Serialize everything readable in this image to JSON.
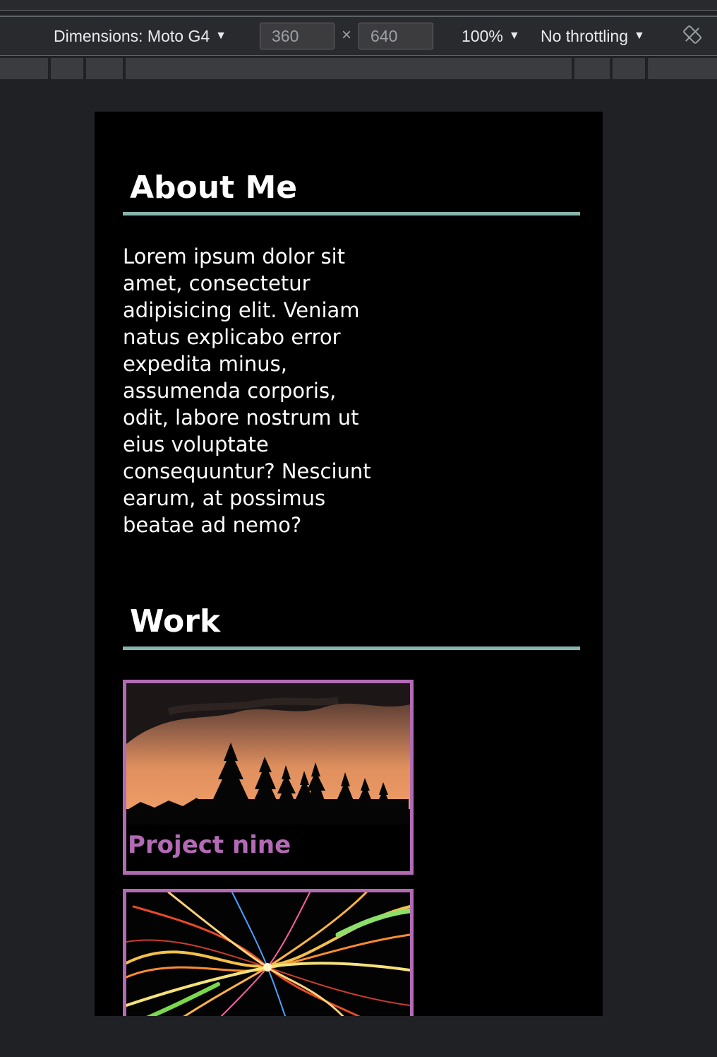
{
  "devtools": {
    "dimensions_label": "Dimensions: Moto G4",
    "width_value": "360",
    "height_value": "640",
    "times_symbol": "×",
    "zoom_label": "100%",
    "throttling_label": "No throttling",
    "caret": "▼"
  },
  "page": {
    "about": {
      "title": "About Me",
      "text": "Lorem ipsum dolor sit amet, consectetur adipisicing elit. Veniam natus explicabo error expedita minus, assumenda corporis, odit, labore nostrum ut eius voluptate consequuntur? Nesciunt earum, at possimus beatae ad nemo?"
    },
    "work": {
      "title": "Work",
      "projects": [
        {
          "label": "Project nine",
          "image": "sunset-forest-image"
        },
        {
          "label": "",
          "image": "light-trails-image"
        }
      ]
    }
  },
  "colors": {
    "accent_rule": "#86b5ad",
    "card_border": "#b36ab5",
    "devtools_bg": "#292a2d"
  }
}
